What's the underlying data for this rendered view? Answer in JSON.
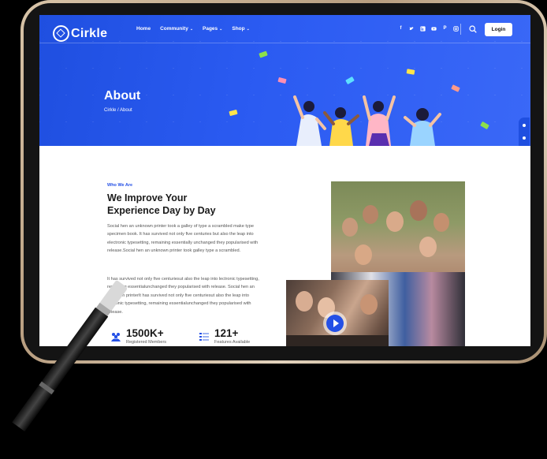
{
  "header": {
    "logo_text": "Cirkle",
    "nav": [
      {
        "label": "Home",
        "dropdown": false
      },
      {
        "label": "Community",
        "dropdown": true
      },
      {
        "label": "Pages",
        "dropdown": true
      },
      {
        "label": "Shop",
        "dropdown": true
      }
    ],
    "social_icons": [
      "facebook-icon",
      "twitter-icon",
      "linkedin-icon",
      "youtube-icon",
      "pinterest-icon",
      "instagram-icon"
    ],
    "login_label": "Login"
  },
  "hero": {
    "title": "About",
    "breadcrumb": "Cirkle / About"
  },
  "about": {
    "eyebrow": "Who We Are",
    "headline_line1": "We Improve Your",
    "headline_line2": "Experience Day by Day",
    "para1": "Social hen an unknown printer took a galley of type a scrambled make type specimen book. It has survived not only five centuries but also the leap into electronic typesetting, remaining essentially unchanged they popularised with release.Social hen an unknown printer took galley type a scrambled.",
    "para2": "It has survived not only five centuriesut also the leap into lectronic typesetting, remaining essentialunchanged they popularised with release. Social hen an unknown printerIt has survived not only five centuriesut also the leap into lectronic typesetting, remaining essentialunchanged they popularised with release."
  },
  "stats": [
    {
      "value": "1500K+",
      "label": "Registered Members"
    },
    {
      "value": "121+",
      "label": "Features Available"
    }
  ],
  "colors": {
    "accent": "#2450e6",
    "hero_blue": "#2b5bf2"
  }
}
